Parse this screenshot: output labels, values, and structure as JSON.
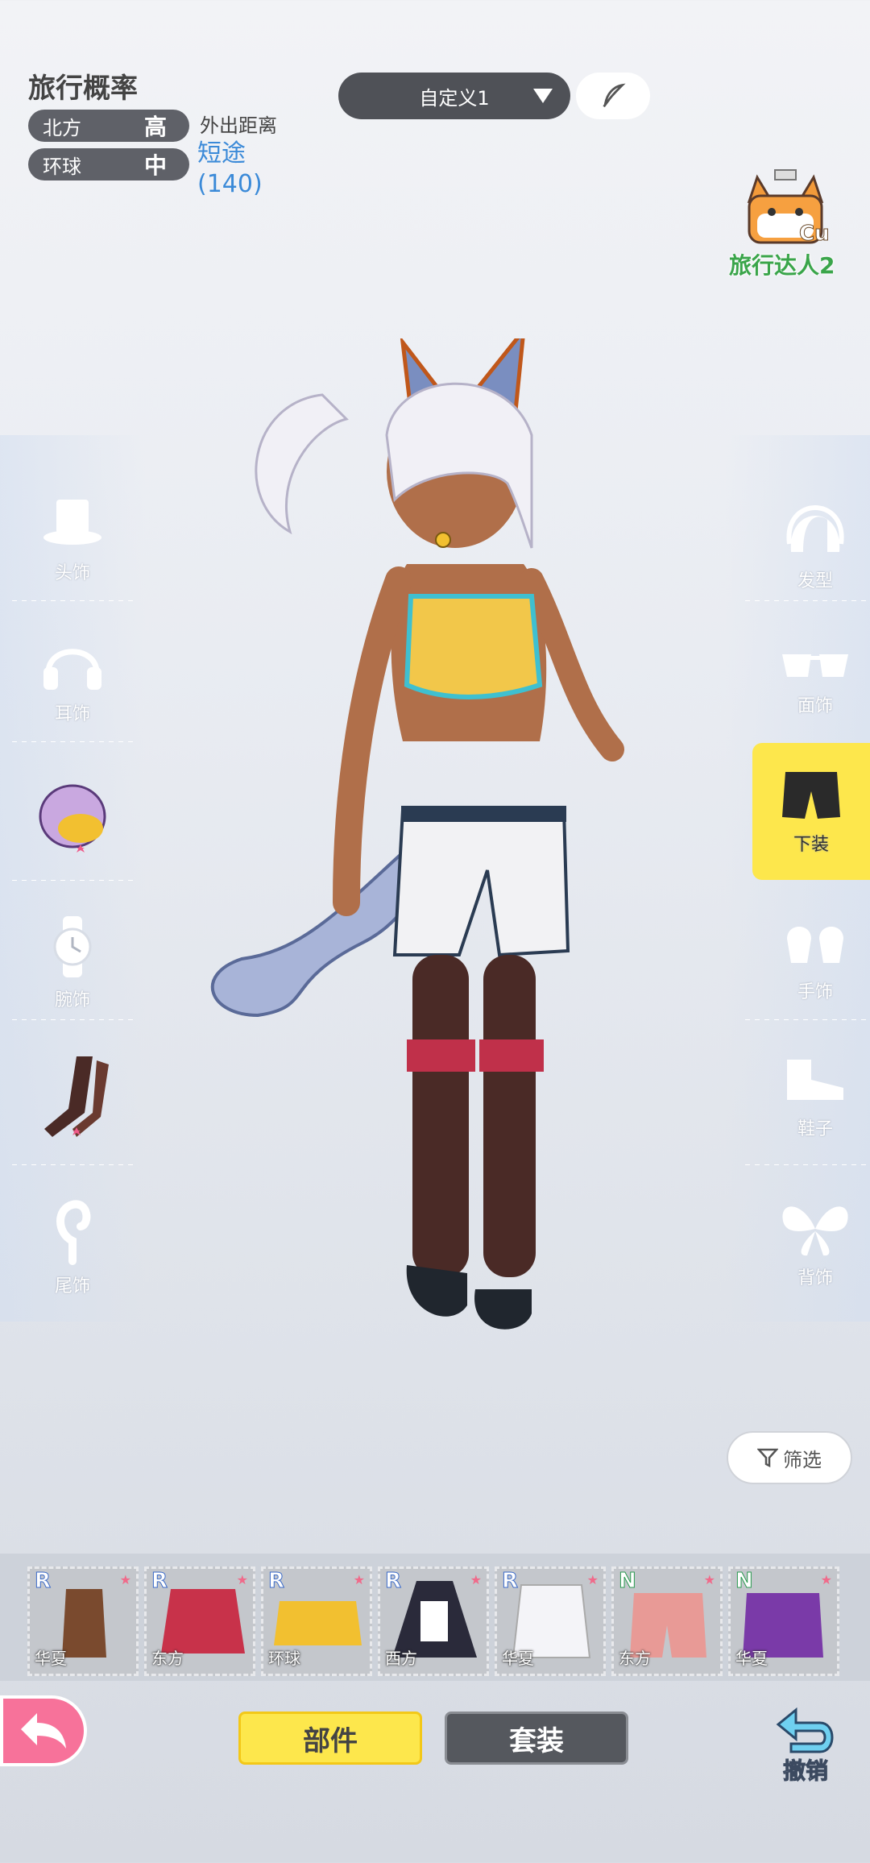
{
  "stats": {
    "title": "旅行概率",
    "rows": [
      {
        "label": "北方",
        "value": "高"
      },
      {
        "label": "环球",
        "value": "中"
      }
    ],
    "distance_label": "外出距离",
    "distance_value": "短途",
    "distance_number": "(140)"
  },
  "preset": {
    "label": "自定义1"
  },
  "badge": {
    "level": "Cu",
    "label": "旅行达人2"
  },
  "left_categories": [
    {
      "label": "头饰",
      "icon": "top-hat-icon"
    },
    {
      "label": "耳饰",
      "icon": "headphones-icon"
    },
    {
      "label": "",
      "icon": "top-outfit-icon"
    },
    {
      "label": "腕饰",
      "icon": "watch-icon"
    },
    {
      "label": "",
      "icon": "stockings-icon"
    },
    {
      "label": "尾饰",
      "icon": "tail-hook-icon"
    }
  ],
  "right_categories": [
    {
      "label": "发型",
      "icon": "hair-icon"
    },
    {
      "label": "面饰",
      "icon": "glasses-icon"
    },
    {
      "label": "下装",
      "icon": "shorts-icon",
      "selected": true
    },
    {
      "label": "手饰",
      "icon": "gloves-icon"
    },
    {
      "label": "鞋子",
      "icon": "shoe-icon"
    },
    {
      "label": "背饰",
      "icon": "wings-icon"
    }
  ],
  "filter": {
    "label": "筛选"
  },
  "items": [
    {
      "rarity": "R",
      "region": "华夏",
      "color": "#7a4a2e"
    },
    {
      "rarity": "R",
      "region": "东方",
      "color": "#c8324a"
    },
    {
      "rarity": "R",
      "region": "环球",
      "color": "#f2c030"
    },
    {
      "rarity": "R",
      "region": "西方",
      "color": "#2a2a3a"
    },
    {
      "rarity": "R",
      "region": "华夏",
      "color": "#f4f4f8"
    },
    {
      "rarity": "N",
      "region": "东方",
      "color": "#e89a96"
    },
    {
      "rarity": "N",
      "region": "华夏",
      "color": "#7a3aa8"
    }
  ],
  "tabs": {
    "parts": "部件",
    "sets": "套装"
  },
  "undo": {
    "label": "撤销"
  }
}
